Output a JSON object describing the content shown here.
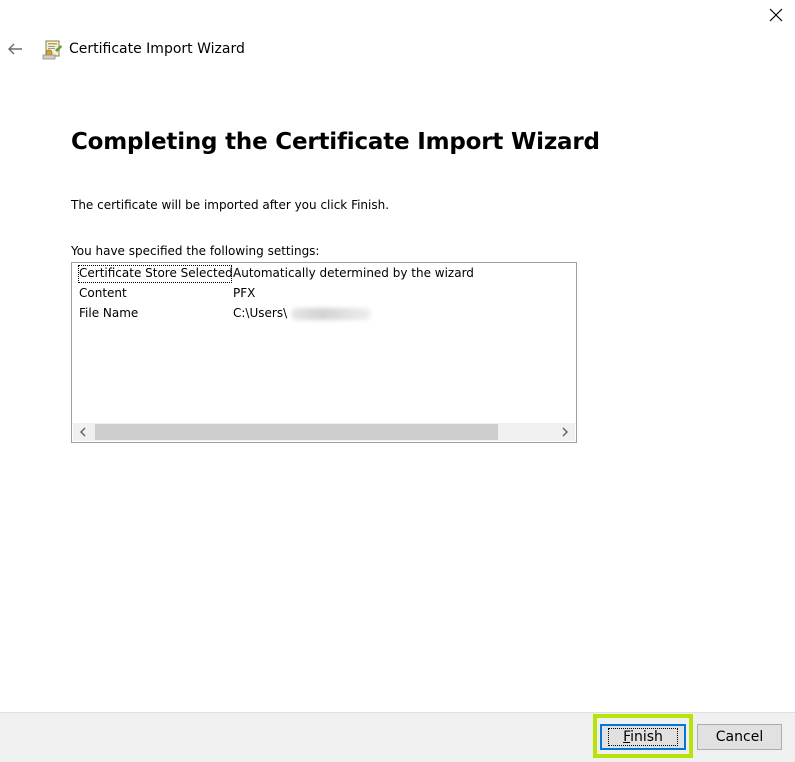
{
  "window": {
    "title": "Certificate Import Wizard"
  },
  "page": {
    "heading": "Completing the Certificate Import Wizard",
    "intro": "The certificate will be imported after you click Finish.",
    "settings_label": "You have specified the following settings:"
  },
  "settings": [
    {
      "name": "Certificate Store Selected",
      "value": "Automatically determined by the wizard"
    },
    {
      "name": "Content",
      "value": "PFX"
    },
    {
      "name": "File Name",
      "value": "C:\\Users\\"
    }
  ],
  "scrollbar": {
    "thumb_fraction": 0.88
  },
  "buttons": {
    "finish_mnemonic": "F",
    "finish_rest": "inish",
    "cancel": "Cancel"
  },
  "colors": {
    "accent": "#0078d7",
    "highlight": "#b7e20a",
    "footer": "#f0f0f0"
  },
  "icons": {
    "close": "close-icon",
    "back": "back-arrow-icon",
    "wizard": "certificate-icon",
    "scroll_left": "chevron-left-icon",
    "scroll_right": "chevron-right-icon"
  }
}
